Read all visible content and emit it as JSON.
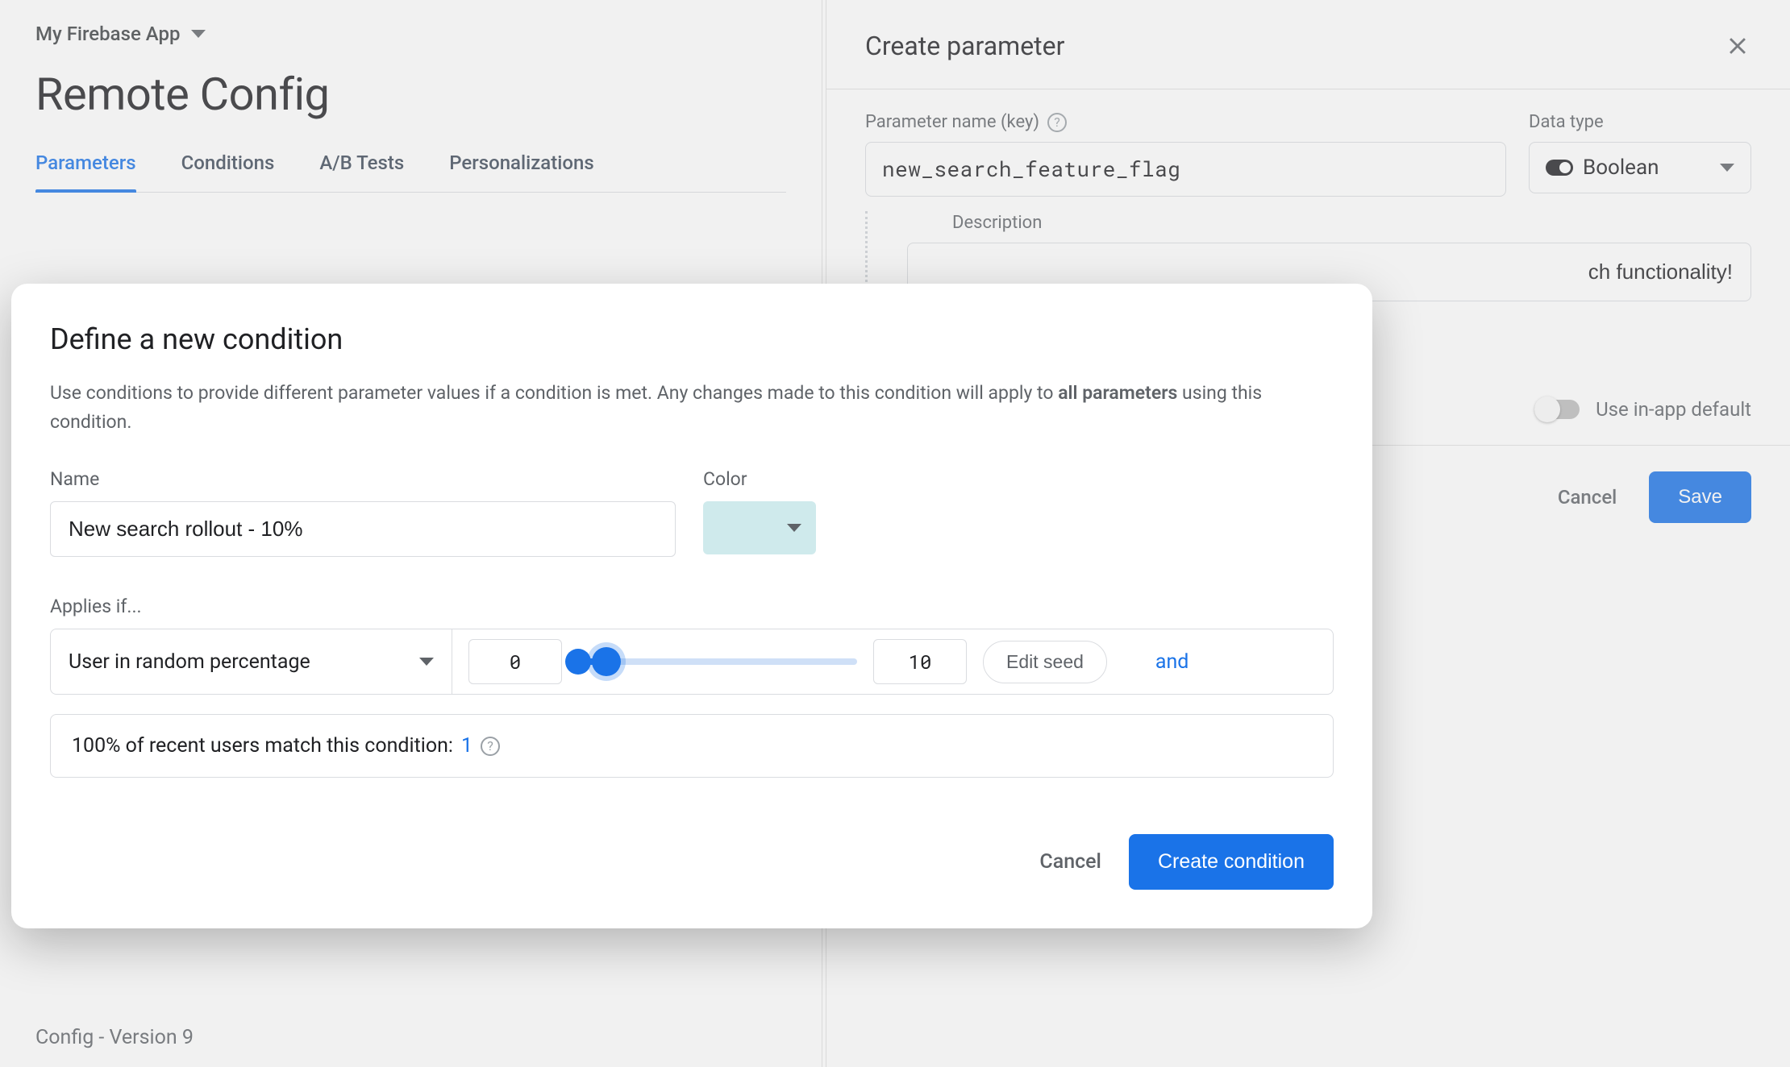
{
  "header": {
    "app_name": "My Firebase App",
    "page_title": "Remote Config"
  },
  "tabs": {
    "parameters": "Parameters",
    "conditions": "Conditions",
    "ab_tests": "A/B Tests",
    "personalizations": "Personalizations"
  },
  "footer": {
    "config_version": "Config - Version 9"
  },
  "side_panel": {
    "title": "Create parameter",
    "param_key_label": "Parameter name (key)",
    "param_key_value": "new_search_feature_flag",
    "data_type_label": "Data type",
    "data_type_value": "Boolean",
    "description_label": "Description",
    "description_value": "ch functionality!",
    "use_default_label": "Use in-app default",
    "cancel": "Cancel",
    "save": "Save"
  },
  "modal": {
    "title": "Define a new condition",
    "desc_part1": "Use conditions to provide different parameter values if a condition is met. Any changes made to this condition will apply to ",
    "desc_bold": "all parameters",
    "desc_part2": " using this condition.",
    "name_label": "Name",
    "name_value": "New search rollout - 10%",
    "color_label": "Color",
    "color_value": "#cfeaec",
    "applies_label": "Applies if...",
    "condition_type": "User in random percentage",
    "range_min": "0",
    "range_max": "10",
    "edit_seed": "Edit seed",
    "and": "and",
    "match_text": "100% of recent users match this condition: ",
    "match_count": "1",
    "cancel": "Cancel",
    "create": "Create condition"
  }
}
